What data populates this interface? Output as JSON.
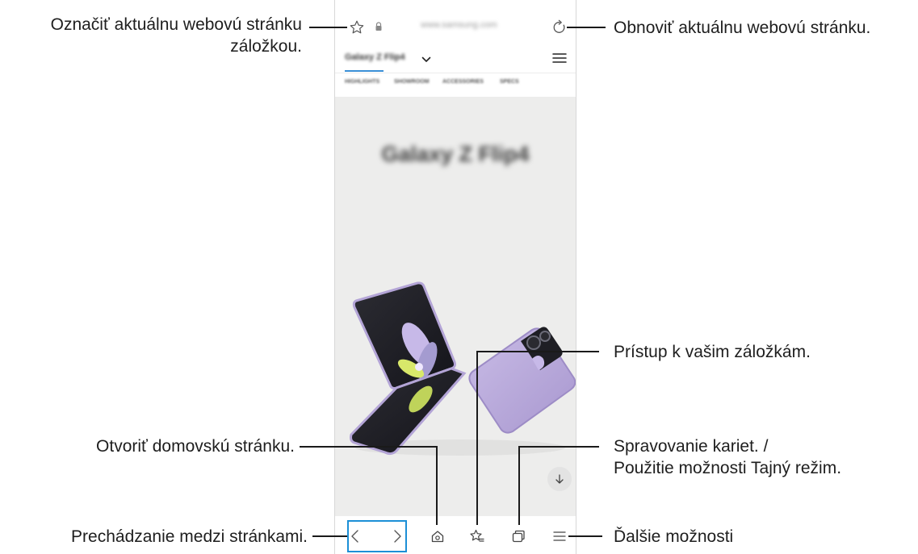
{
  "browser": {
    "url": "www.samsung.com",
    "page_title": "Galaxy Z Flip4",
    "tabs": [
      "HIGHLIGHTS",
      "SHOWROOM",
      "ACCESSORIES",
      "SPECS"
    ],
    "hero_title": "Galaxy Z Flip4"
  },
  "annotations": {
    "bookmark_line1": "Označiť aktuálnu webovú stránku",
    "bookmark_line2": "záložkou.",
    "refresh": "Obnoviť aktuálnu webovú stránku.",
    "bookmarks": "Prístup k vašim záložkám.",
    "home": "Otvoriť domovskú stránku.",
    "tabs_line1": "Spravovanie kariet. /",
    "tabs_line2": "Použitie možnosti Tajný režim.",
    "navigate": "Prechádzanie medzi stránkami.",
    "more": "Ďalšie možnosti"
  },
  "colors": {
    "accent": "#1c8fd6",
    "phone_lilac": "#b7a6d8",
    "hero_bg": "#ededec"
  }
}
